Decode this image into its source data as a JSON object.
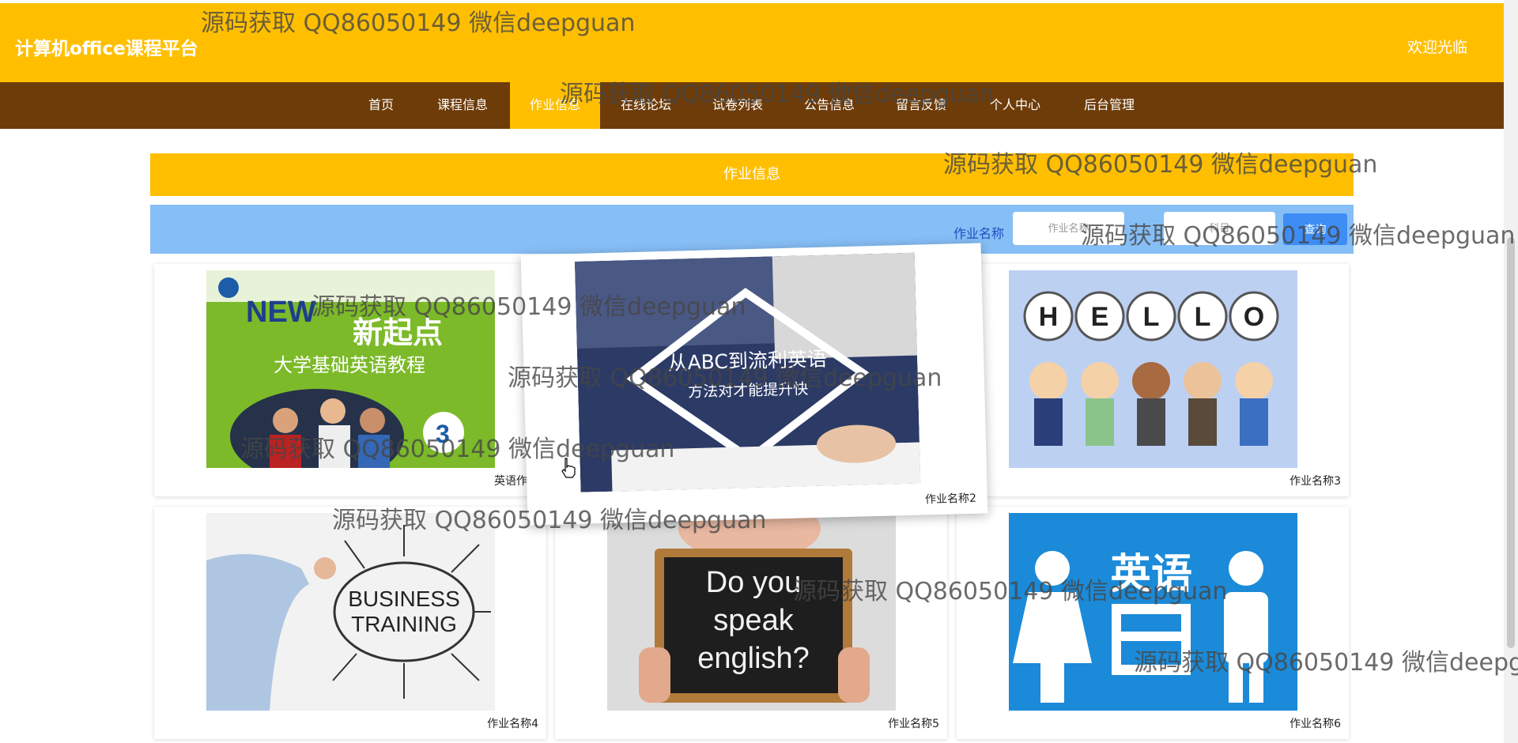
{
  "header": {
    "site_title": "计算机office课程平台",
    "welcome": "欢迎光临"
  },
  "nav": {
    "items": [
      "首页",
      "课程信息",
      "作业信息",
      "在线论坛",
      "试卷列表",
      "公告信息",
      "留言反馈",
      "个人中心",
      "后台管理"
    ],
    "active": "作业信息"
  },
  "page": {
    "title": "作业信息"
  },
  "search": {
    "label": "作业名称",
    "name_placeholder": "作业名称",
    "course_placeholder": "科目",
    "button_label": "查询"
  },
  "cards": [
    {
      "caption": "英语作业",
      "image": "new-starting-point-english-textbook"
    },
    {
      "caption": "作业名称2",
      "image": "abc-to-fluent-english-student"
    },
    {
      "caption": "作业名称3",
      "image": "hello-cartoon-kids"
    },
    {
      "caption": "作业名称4",
      "image": "business-training-sketch"
    },
    {
      "caption": "作业名称5",
      "image": "do-you-speak-english-chalkboard"
    },
    {
      "caption": "作业名称6",
      "image": "english-daily-conversation-icons"
    }
  ],
  "watermark": "源码获取 QQ86050149 微信deepguan",
  "images_text": {
    "textbook_title": "新起点",
    "textbook_subtitle": "大学基础英语教程",
    "abc_line1": "从ABC到流利英语",
    "abc_line2": "方法对才能提升快",
    "hello_letters": [
      "H",
      "E",
      "L",
      "L",
      "O"
    ],
    "business_line1": "BUSINESS",
    "business_line2": "TRAINING",
    "chalk_line1": "Do you",
    "chalk_line2": "speak",
    "chalk_line3": "english?",
    "english_icon_text": "英语"
  },
  "colors": {
    "header_yellow": "#FFBF00",
    "nav_brown": "#6E3C09",
    "search_blue": "#86BEF6",
    "button_blue": "#3D8DF5"
  }
}
